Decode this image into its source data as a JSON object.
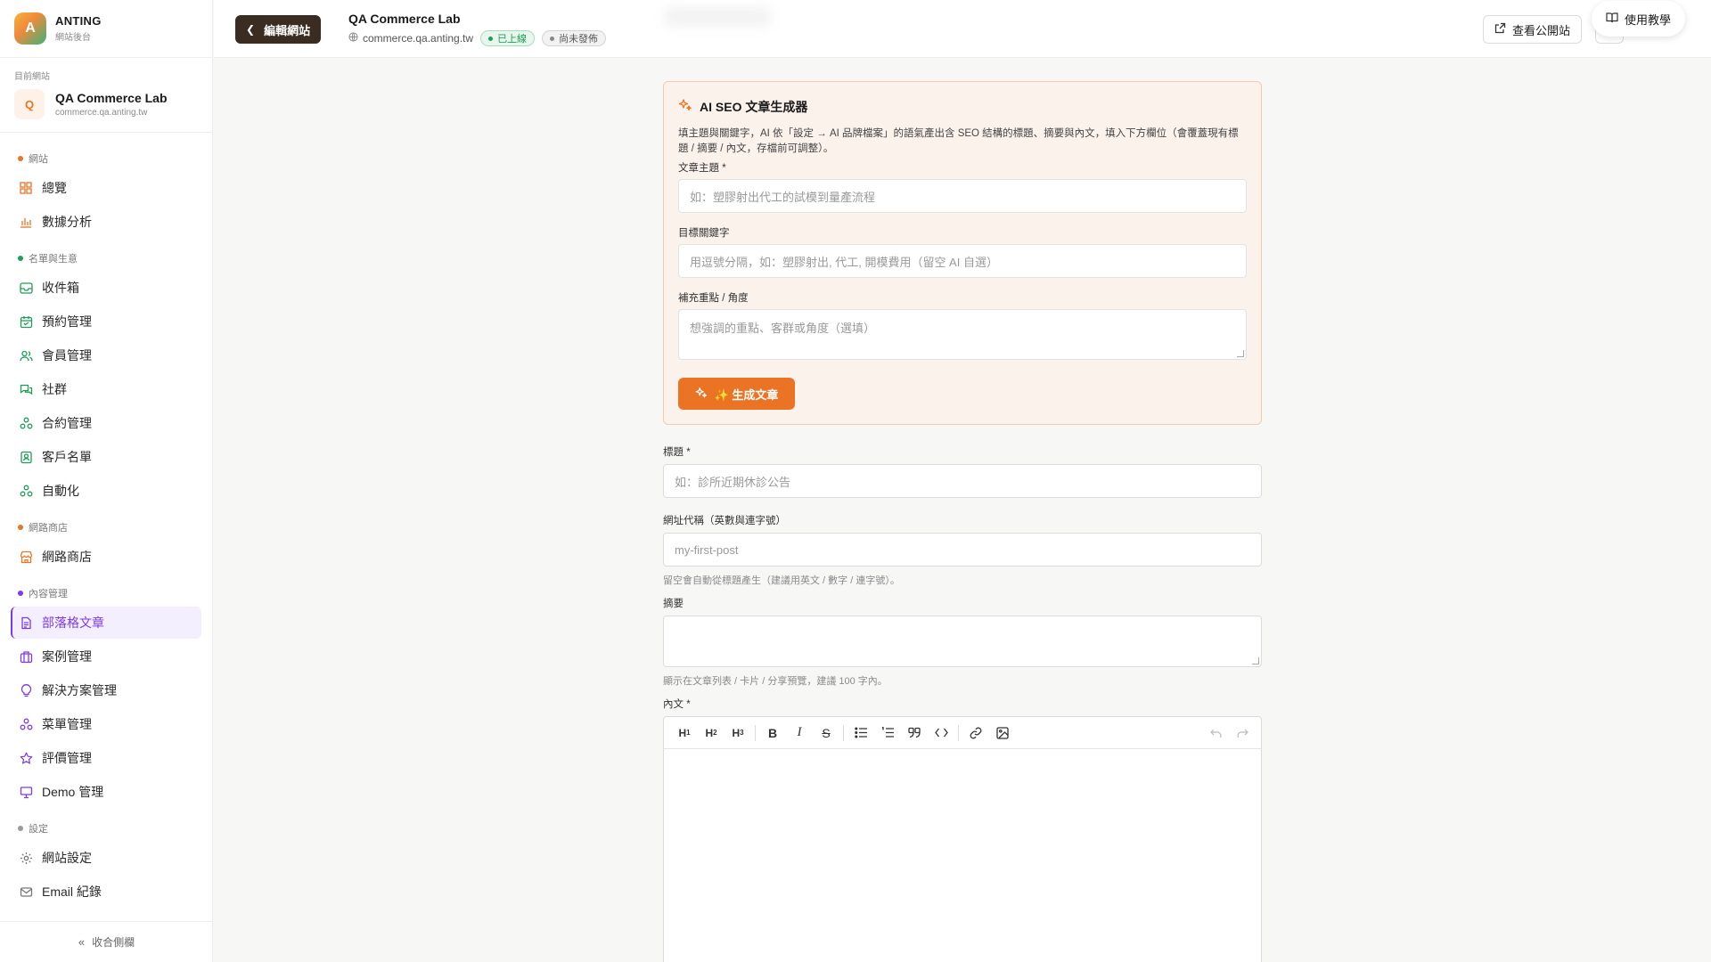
{
  "brand": {
    "logo_letter": "A",
    "name": "ANTING",
    "sub": "網站後台"
  },
  "current_site": {
    "caption": "目前網站",
    "badge": "Q",
    "name": "QA Commerce Lab",
    "domain": "commerce.qa.anting.tw"
  },
  "nav": {
    "groups": [
      {
        "label": "網站",
        "dot_color": "#ea7424",
        "items": [
          {
            "label": "總覽",
            "icon": "grid-icon"
          },
          {
            "label": "數據分析",
            "icon": "bar-chart-icon"
          }
        ]
      },
      {
        "label": "名單與生意",
        "dot_color": "#1f9d57",
        "items": [
          {
            "label": "收件箱",
            "icon": "inbox-icon"
          },
          {
            "label": "預約管理",
            "icon": "calendar-icon"
          },
          {
            "label": "會員管理",
            "icon": "users-icon"
          },
          {
            "label": "社群",
            "icon": "chat-icon"
          },
          {
            "label": "合約管理",
            "icon": "workflow-icon"
          },
          {
            "label": "客戶名單",
            "icon": "contact-icon"
          },
          {
            "label": "自動化",
            "icon": "workflow-icon"
          }
        ]
      },
      {
        "label": "網路商店",
        "dot_color": "#ea7424",
        "items": [
          {
            "label": "網路商店",
            "icon": "store-icon"
          }
        ]
      },
      {
        "label": "內容管理",
        "dot_color": "#7c3aed",
        "items": [
          {
            "label": "部落格文章",
            "icon": "document-icon",
            "active": true
          },
          {
            "label": "案例管理",
            "icon": "briefcase-icon"
          },
          {
            "label": "解決方案管理",
            "icon": "lightbulb-icon"
          },
          {
            "label": "菜單管理",
            "icon": "workflow-icon"
          },
          {
            "label": "評價管理",
            "icon": "star-icon"
          },
          {
            "label": "Demo 管理",
            "icon": "presentation-icon"
          }
        ]
      },
      {
        "label": "設定",
        "dot_color": "#9a9a9a",
        "items": [
          {
            "label": "網站設定",
            "icon": "gear-icon"
          },
          {
            "label": "Email 紀錄",
            "icon": "mail-icon"
          }
        ]
      }
    ],
    "collapse_label": "收合側欄"
  },
  "topbar": {
    "back_label": "編輯網站",
    "site_name": "QA Commerce Lab",
    "site_domain": "commerce.qa.anting.tw",
    "status_live": "已上線",
    "status_draft": "尚未發佈",
    "view_site_label": "查看公開站",
    "tutorial_label": "使用教學"
  },
  "ai_card": {
    "title": "AI SEO 文章生成器",
    "description": "填主題與關鍵字，AI 依「設定 → AI 品牌檔案」的語氣產出含 SEO 結構的標題、摘要與內文，填入下方欄位（會覆蓋現有標題 / 摘要 / 內文，存檔前可調整）。",
    "topic_label": "文章主題 *",
    "topic_placeholder": "如：塑膠射出代工的試模到量產流程",
    "keywords_label": "目標關鍵字",
    "keywords_placeholder": "用逗號分隔，如：塑膠射出, 代工, 開模費用（留空 AI 自選）",
    "angle_label": "補充重點 / 角度",
    "angle_placeholder": "想強調的重點、客群或角度（選填）",
    "generate_label": "✨ 生成文章"
  },
  "form": {
    "title_label": "標題 *",
    "title_placeholder": "如：診所近期休診公告",
    "slug_label": "網址代稱（英數與連字號）",
    "slug_placeholder": "my-first-post",
    "slug_hint": "留空會自動從標題產生（建議用英文 / 數字 / 連字號）。",
    "summary_label": "摘要",
    "summary_hint": "顯示在文章列表 / 卡片 / 分享預覽，建議 100 字內。",
    "content_label": "內文 *"
  },
  "editor_toolbar": {
    "buttons": [
      "heading1-icon",
      "heading2-icon",
      "heading3-icon",
      "bold-icon",
      "italic-icon",
      "strikethrough-icon",
      "bullet-list-icon",
      "ordered-list-icon",
      "quote-icon",
      "code-icon",
      "link-icon",
      "image-icon",
      "undo-icon",
      "redo-icon"
    ]
  }
}
